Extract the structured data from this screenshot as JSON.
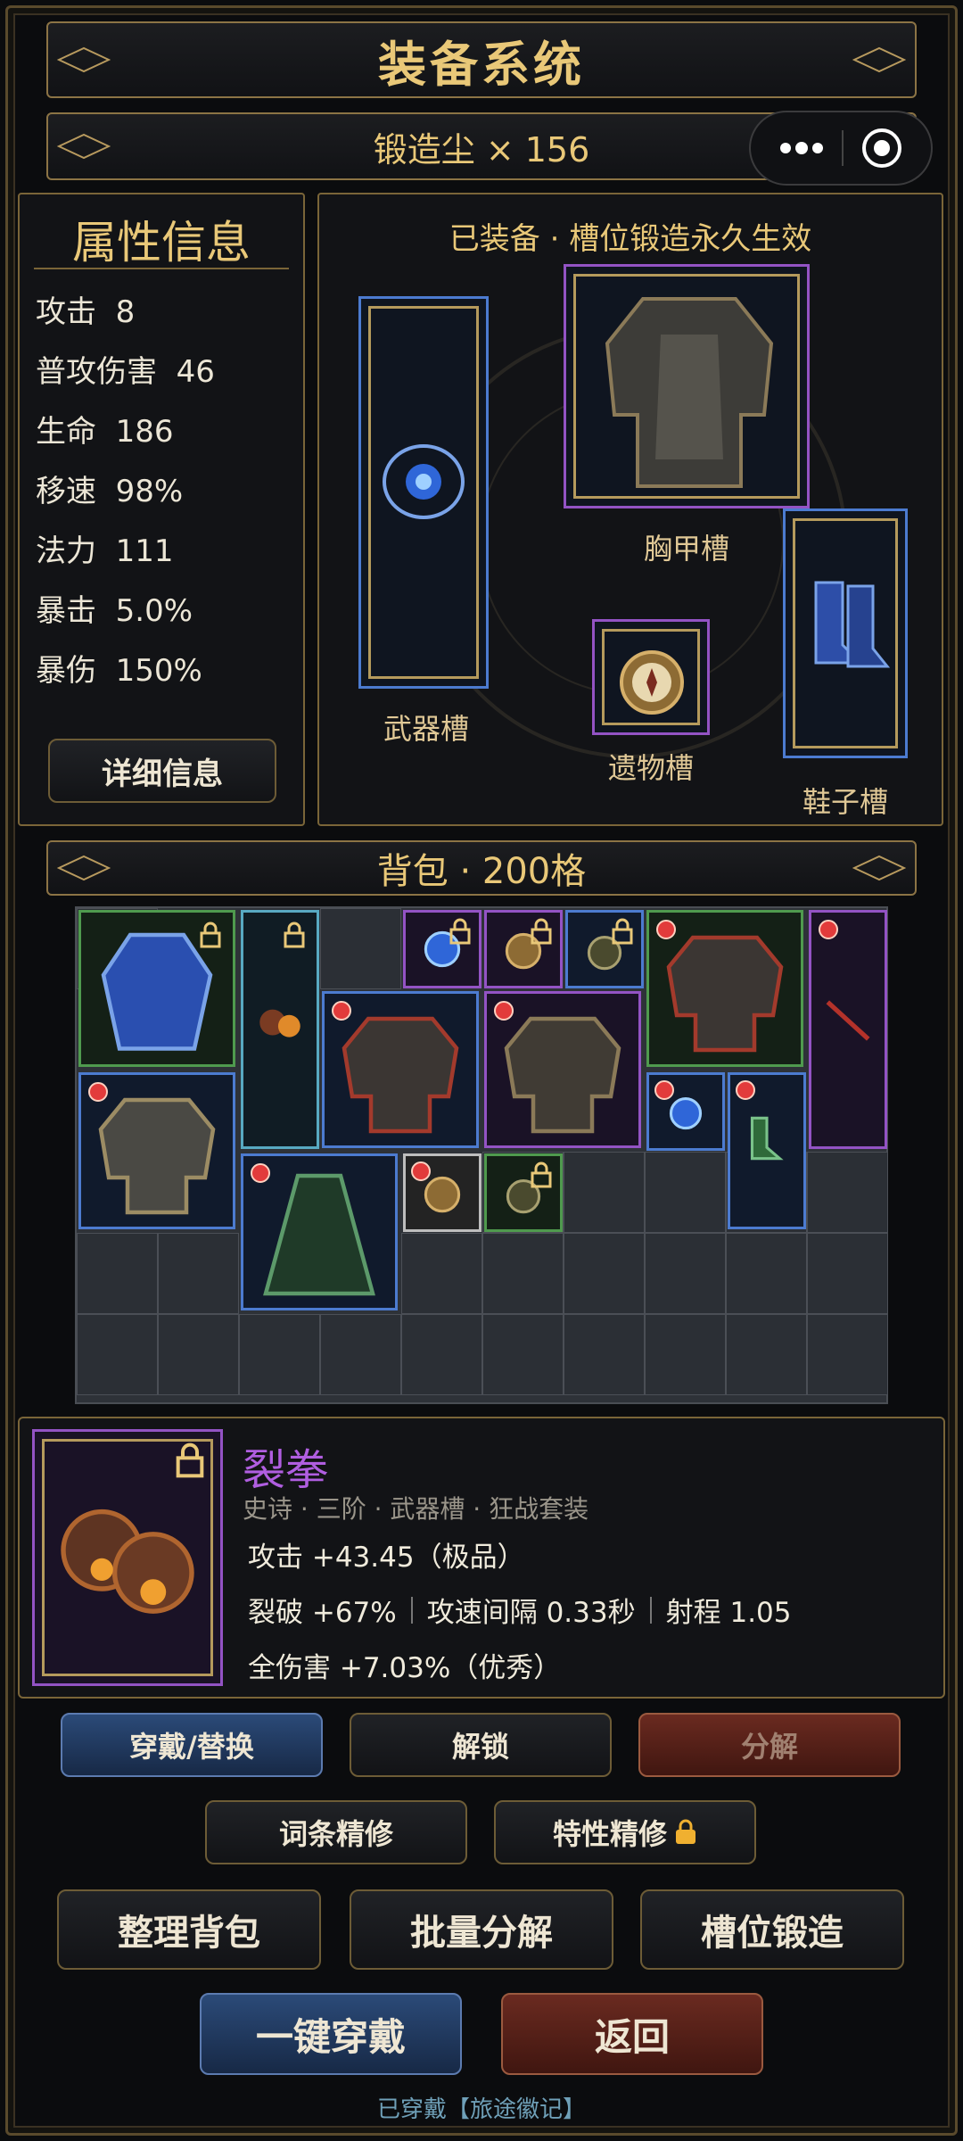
{
  "header": {
    "title": "装备系统",
    "currency": "锻造尘 × 156"
  },
  "attributes": {
    "title": "属性信息",
    "items": [
      {
        "name": "攻击",
        "value": "8"
      },
      {
        "name": "普攻伤害",
        "value": "46"
      },
      {
        "name": "生命",
        "value": "186"
      },
      {
        "name": "移速",
        "value": "98%"
      },
      {
        "name": "法力",
        "value": "111"
      },
      {
        "name": "暴击",
        "value": "5.0%"
      },
      {
        "name": "暴伤",
        "value": "150%"
      }
    ],
    "detail_button": "详细信息"
  },
  "equipped": {
    "title": "已装备 · 槽位锻造永久生效",
    "slots": {
      "weapon": "武器槽",
      "chest": "胸甲槽",
      "relic": "遗物槽",
      "shoes": "鞋子槽"
    }
  },
  "backpack": {
    "title": "背包 · 200格"
  },
  "item_detail": {
    "name": "裂拳",
    "meta": "史诗 · 三阶 · 武器槽 · 狂战套装",
    "line1": "攻击 +43.45（极品）",
    "line2a": "裂破 +67%",
    "line2b": "攻速间隔 0.33秒",
    "line2c": "射程 1.05",
    "line3": "全伤害 +7.03%（优秀）"
  },
  "actions": {
    "equip_replace": "穿戴/替换",
    "unlock": "解锁",
    "decompose": "分解",
    "affix_refine": "词条精修",
    "trait_refine": "特性精修",
    "sort_bag": "整理背包",
    "batch_decompose": "批量分解",
    "slot_forge": "槽位锻造",
    "one_click_equip": "一键穿戴",
    "back": "返回"
  },
  "footer": {
    "status": "已穿戴【旅途徽记】"
  },
  "colors": {
    "gold": "#e9c878",
    "epic": "#b05ee0",
    "rare": "#4c7bd0",
    "uncommon": "#4f9a4e"
  }
}
